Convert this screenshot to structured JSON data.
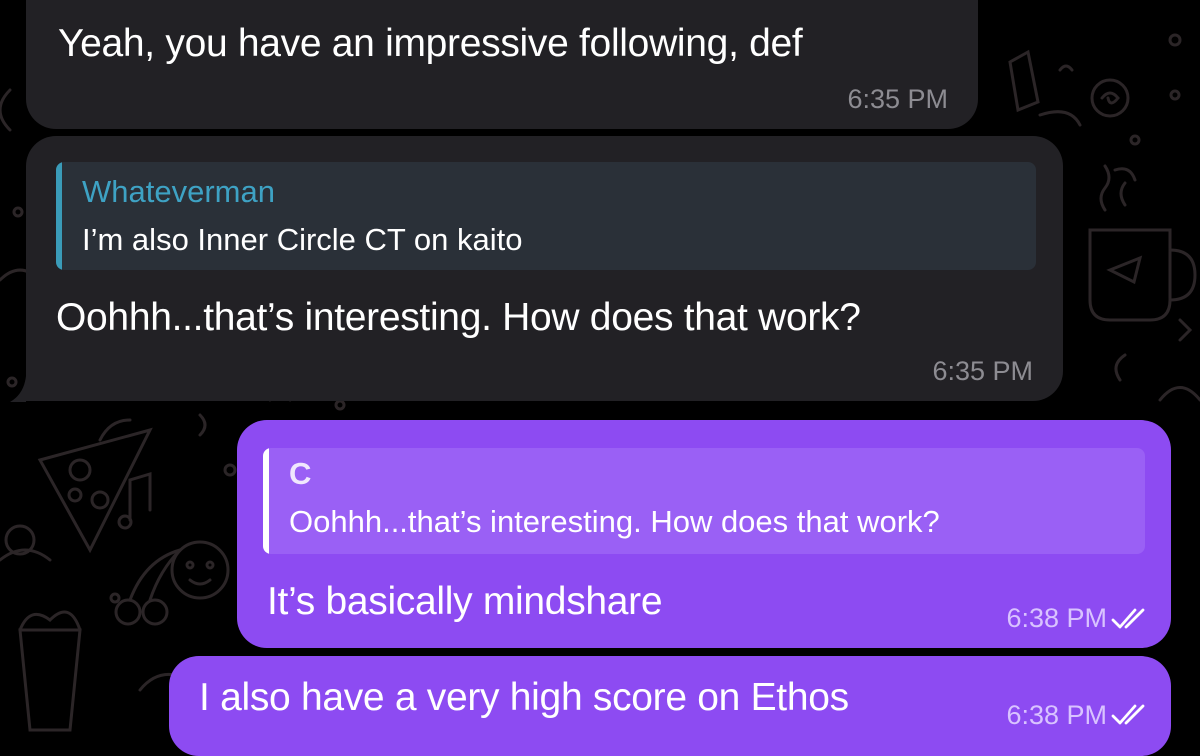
{
  "chat": {
    "messages": [
      {
        "id": "m1",
        "direction": "incoming",
        "text": "Yeah, you have an impressive following, def",
        "time": "6:35 PM"
      },
      {
        "id": "m2",
        "direction": "incoming",
        "reply": {
          "author": "Whateverman",
          "text": "I’m also Inner Circle CT on kaito"
        },
        "text": "Oohhh...that’s interesting. How does that work?",
        "time": "6:35 PM"
      },
      {
        "id": "m3",
        "direction": "outgoing",
        "reply": {
          "author": "C",
          "text": "Oohhh...that’s interesting. How does that work?"
        },
        "text": "It’s basically mindshare",
        "time": "6:38 PM",
        "status": "read-double-check-icon"
      },
      {
        "id": "m4",
        "direction": "outgoing",
        "text": "I also have a very high score on Ethos",
        "time": "6:38 PM",
        "status": "read-double-check-icon"
      }
    ]
  },
  "colors": {
    "background": "#000000",
    "incoming_bubble": "#222125",
    "outgoing_bubble": "#8d4bf2",
    "reply_accent_incoming": "#3a9bb8",
    "reply_name_incoming": "#3ea2c4",
    "doodle_stroke": "#2b2527"
  }
}
